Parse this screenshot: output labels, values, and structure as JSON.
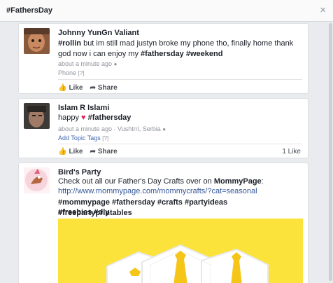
{
  "header": {
    "title": "#FathersDay",
    "close_icon": "×"
  },
  "posts": [
    {
      "author": "Johnny YunGn Valiant",
      "text_parts": [
        "#rollin",
        " but im still mad justyn broke my phone tho, finally home thank god now i can enjoy my ",
        "#fathersday",
        " ",
        "#weekend"
      ],
      "time": "about a minute ago",
      "source": "Phone",
      "like_label": "Like",
      "share_label": "Share"
    },
    {
      "author": "Islam R Islami",
      "text_before": "happy",
      "hashtag": "#fathersday",
      "time": "about a minute ago · Vushtrri, Serbia",
      "add_tags": "Add Topic Tags",
      "like_label": "Like",
      "share_label": "Share",
      "like_count": "1 Like"
    },
    {
      "author": "Bird's Party",
      "text_before": "Check out all our Father's Day Crafts over on ",
      "text_bold": "MommyPage",
      "text_after": ":",
      "url": "http://www.mommypage.com/mommycrafts/?cat=seasonal",
      "hashtags_line1": "#mommypage #fathersday #crafts #partyideas #freepartyprintables",
      "hashtags_line2": "#freebies #diy"
    }
  ],
  "colors": {
    "accent": "#365899",
    "photo_bg": "#fbe33b",
    "background": "#e9ebee"
  }
}
